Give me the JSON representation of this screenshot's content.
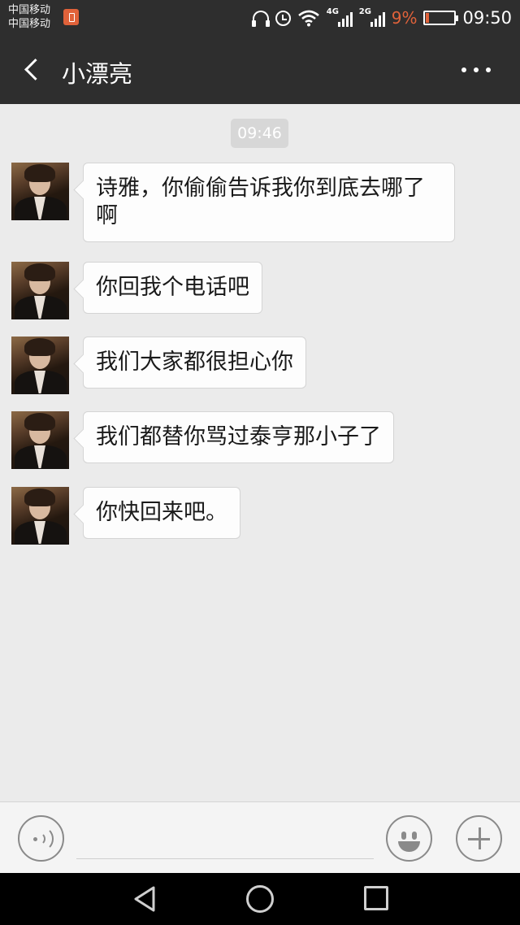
{
  "status_bar": {
    "carrier_1": "中国移动",
    "carrier_2": "中国移动",
    "network_1": "4G",
    "network_2": "2G",
    "battery_percent": "9%",
    "battery_level": 0.09,
    "time": "09:50",
    "icons": [
      "sim-icon",
      "headphone-icon",
      "alarm-icon",
      "wifi-icon",
      "signal-icon",
      "battery-icon"
    ],
    "accent_color": "#e0623a"
  },
  "header": {
    "title": "小漂亮",
    "back_icon": "chevron-left-icon",
    "more_icon": "more-dots-icon"
  },
  "chat": {
    "timestamp": "09:46",
    "messages": [
      {
        "text": "诗雅，你偷偷告诉我你到底去哪了啊"
      },
      {
        "text": "你回我个电话吧"
      },
      {
        "text": "我们大家都很担心你"
      },
      {
        "text": "我们都替你骂过泰亨那小子了"
      },
      {
        "text": "你快回来吧。"
      }
    ]
  },
  "input_bar": {
    "voice_icon": "voice-icon",
    "text_value": "",
    "emoji_icon": "emoji-icon",
    "plus_icon": "plus-icon"
  },
  "nav_bar": {
    "icons": [
      "nav-back-icon",
      "nav-home-icon",
      "nav-recent-icon"
    ]
  }
}
